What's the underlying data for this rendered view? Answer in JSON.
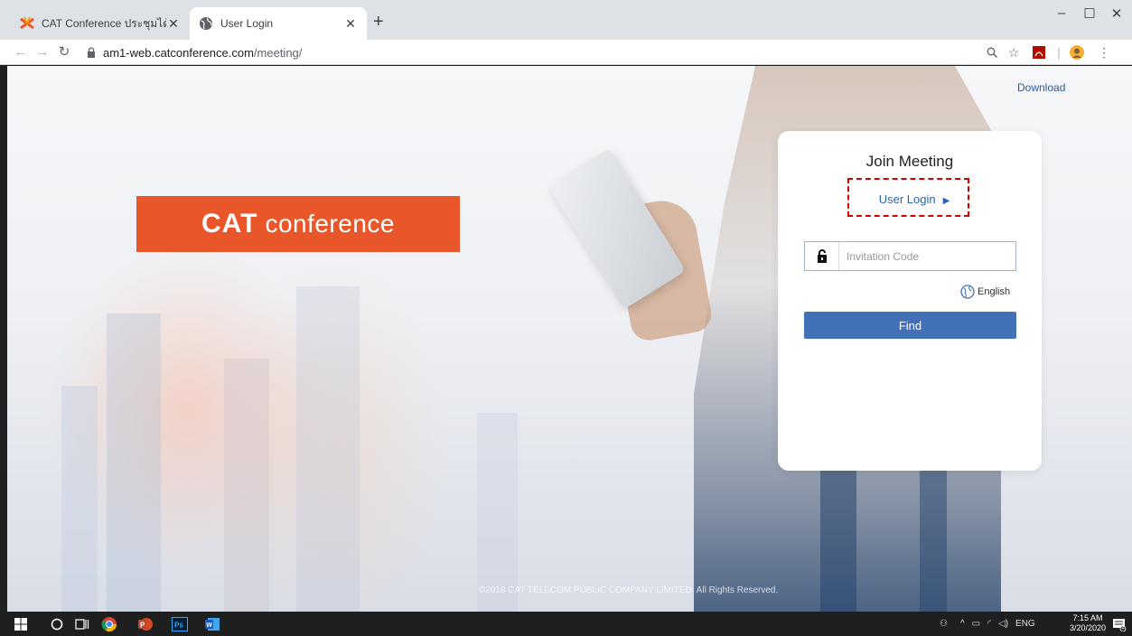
{
  "browser": {
    "tabs": [
      {
        "title": "CAT Conference ประชุมได้ไร้ขีดจำกัด",
        "active": false,
        "icon": "catconference-favicon"
      },
      {
        "title": "User Login",
        "active": true,
        "icon": "globe-favicon"
      }
    ],
    "url_host": "am1-web.catconference.com",
    "url_path": "/meeting/"
  },
  "page": {
    "download_label": "Download",
    "brand": {
      "bold": "CAT",
      "light": "conference",
      "color": "#e8562a"
    },
    "card": {
      "heading": "Join Meeting",
      "user_login_label": "User Login",
      "invitation_placeholder": "Invitation Code",
      "language": "English",
      "find_label": "Find"
    },
    "copyright": "©2018 CAT TELECOM PUBLIC COMPANY LIMITED. All Rights Reserved."
  },
  "taskbar": {
    "input_lang": "ENG",
    "time": "7:15 AM",
    "date": "3/20/2020",
    "notification_count": "1"
  },
  "colors": {
    "accent": "#4371b7",
    "link": "#2f63b3",
    "highlight_box": "#d40000"
  }
}
